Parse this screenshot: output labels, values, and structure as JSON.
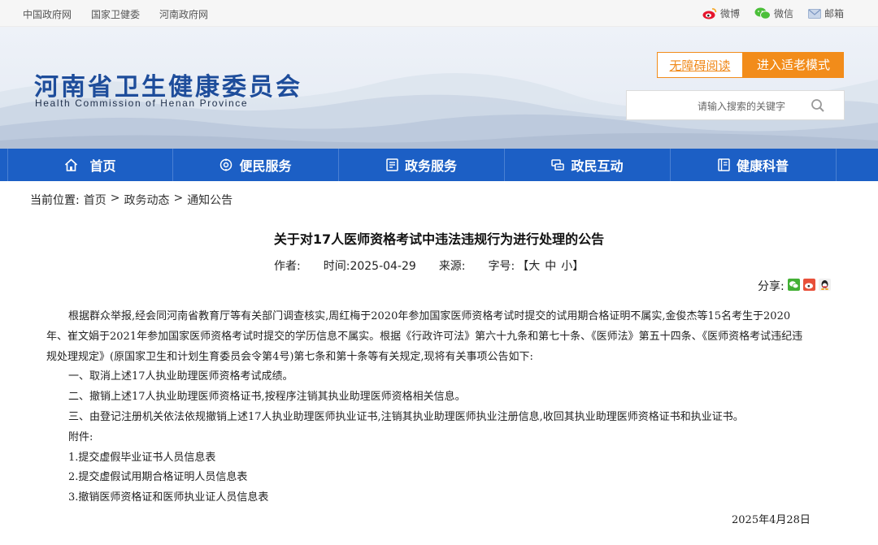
{
  "topbar": {
    "links": [
      "中国政府网",
      "国家卫健委",
      "河南政府网"
    ],
    "social": [
      {
        "label": "微博",
        "icon": "weibo-icon"
      },
      {
        "label": "微信",
        "icon": "wechat-icon"
      },
      {
        "label": "邮箱",
        "icon": "mail-icon"
      }
    ]
  },
  "header": {
    "logo_cn": "河南省卫生健康委员会",
    "logo_en": "Health Commission of Henan Province",
    "accessibility_label": "无障碍阅读",
    "elder_mode_label": "进入适老模式",
    "search_placeholder": "请输入搜索的关键字"
  },
  "nav": {
    "items": [
      {
        "label": "首页",
        "icon": "home-icon"
      },
      {
        "label": "便民服务",
        "icon": "service-icon"
      },
      {
        "label": "政务服务",
        "icon": "document-icon"
      },
      {
        "label": "政民互动",
        "icon": "interaction-icon"
      },
      {
        "label": "健康科普",
        "icon": "book-icon"
      }
    ]
  },
  "breadcrumb": {
    "label": "当前位置:",
    "items": [
      "首页",
      "政务动态",
      "通知公告"
    ],
    "separator": ">"
  },
  "article": {
    "title": "关于对17人医师资格考试中违法违规行为进行处理的公告",
    "author_label": "作者:",
    "time_label": "时间:",
    "time_value": "2025-04-29",
    "source_label": "来源:",
    "fontsize_label": "字号:",
    "fontsize_options": [
      "【大",
      "中",
      "小】"
    ],
    "share_label": "分享:",
    "paragraph_intro": "根据群众举报,经会同河南省教育厅等有关部门调查核实,周红梅于2020年参加国家医师资格考试时提交的试用期合格证明不属实,金俊杰等15名考生于2020年、崔文娟于2021年参加国家医师资格考试时提交的学历信息不属实。根据《行政许可法》第六十九条和第七十条、《医师法》第五十四条、《医师资格考试违纪违规处理规定》(原国家卫生和计划生育委员会令第4号)第七条和第十条等有关规定,现将有关事项公告如下:",
    "items": [
      "一、取消上述17人执业助理医师资格考试成绩。",
      "二、撤销上述17人执业助理医师资格证书,按程序注销其执业助理医师资格相关信息。",
      "三、由登记注册机关依法依规撤销上述17人执业助理医师执业证书,注销其执业助理医师执业注册信息,收回其执业助理医师资格证书和执业证书。",
      "附件:",
      "1.提交虚假毕业证书人员信息表",
      "2.提交虚假试用期合格证明人员信息表",
      "3.撤销医师资格证和医师执业证人员信息表"
    ],
    "date": "2025年4月28日"
  },
  "colors": {
    "nav_bg": "#1c5fc5",
    "logo": "#1e4d9b",
    "accent_orange": "#f28c1a"
  }
}
